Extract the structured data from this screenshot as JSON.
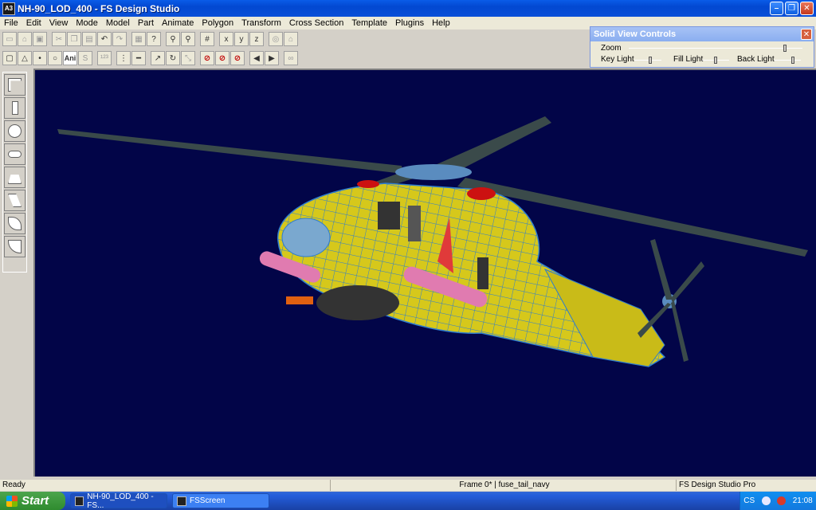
{
  "window": {
    "app_icon_text": "A3",
    "title": "NH-90_LOD_400 - FS Design Studio"
  },
  "menu": [
    "File",
    "Edit",
    "View",
    "Mode",
    "Model",
    "Part",
    "Animate",
    "Polygon",
    "Transform",
    "Cross Section",
    "Template",
    "Plugins",
    "Help"
  ],
  "toolbar2": {
    "ani_label": "Ani"
  },
  "solid_view_controls": {
    "title": "Solid View Controls",
    "close_glyph": "✕",
    "zoom_label": "Zoom",
    "key_light_label": "Key Light",
    "fill_light_label": "Fill Light",
    "back_light_label": "Back Light",
    "zoom_value": 0.9,
    "key_light_value": 0.6,
    "fill_light_value": 0.5,
    "back_light_value": 0.7
  },
  "status": {
    "left": "Ready",
    "frame": "Frame 0* | fuse_tail_navy",
    "product": "FS Design Studio Pro"
  },
  "taskbar": {
    "start_label": "Start",
    "tasks": [
      "NH-90_LOD_400 - FS...",
      "FSScreen"
    ],
    "lang": "CS",
    "clock": "21:08"
  },
  "colors": {
    "viewport_bg": "#020548",
    "fuselage": "#d7c91c",
    "wireframe": "#2f7fd0",
    "rotor": "#3a4a4a",
    "tanks": "#e07bb0"
  }
}
